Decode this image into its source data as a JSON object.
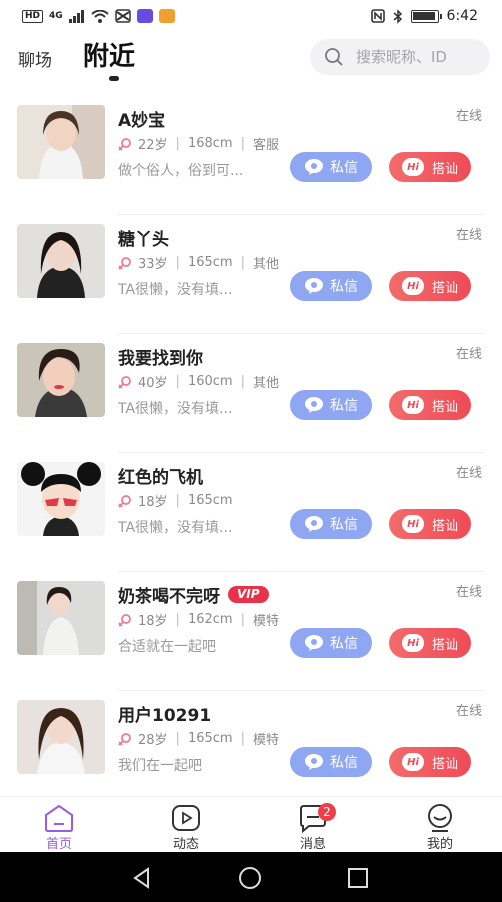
{
  "status_bar": {
    "hd": "HD",
    "signal": "4G",
    "time": "6:42"
  },
  "header": {
    "tab_plaza": "聊场",
    "tab_nearby": "附近",
    "search_placeholder": "搜索昵称、ID"
  },
  "users": [
    {
      "name": "A妙宝",
      "vip": false,
      "online": "在线",
      "age": "22岁",
      "height": "168cm",
      "job": "客服",
      "bio": "做个俗人，俗到可...",
      "msg_label": "私信",
      "hi_label": "搭讪",
      "hi_badge": "Hi"
    },
    {
      "name": "糖丫头",
      "vip": false,
      "online": "在线",
      "age": "33岁",
      "height": "165cm",
      "job": "其他",
      "bio": "TA很懒，没有填...",
      "msg_label": "私信",
      "hi_label": "搭讪",
      "hi_badge": "Hi"
    },
    {
      "name": "我要找到你",
      "vip": false,
      "online": "在线",
      "age": "40岁",
      "height": "160cm",
      "job": "其他",
      "bio": "TA很懒，没有填...",
      "msg_label": "私信",
      "hi_label": "搭讪",
      "hi_badge": "Hi"
    },
    {
      "name": "红色的飞机",
      "vip": false,
      "online": "在线",
      "age": "18岁",
      "height": "165cm",
      "job": "",
      "bio": "TA很懒，没有填...",
      "msg_label": "私信",
      "hi_label": "搭讪",
      "hi_badge": "Hi"
    },
    {
      "name": "奶茶喝不完呀",
      "vip": true,
      "vip_label": "VIP",
      "online": "在线",
      "age": "18岁",
      "height": "162cm",
      "job": "模特",
      "bio": "合适就在一起吧",
      "msg_label": "私信",
      "hi_label": "搭讪",
      "hi_badge": "Hi"
    },
    {
      "name": "用户10291",
      "vip": false,
      "online": "在线",
      "age": "28岁",
      "height": "165cm",
      "job": "模特",
      "bio": "我们在一起吧",
      "msg_label": "私信",
      "hi_label": "搭讪",
      "hi_badge": "Hi"
    }
  ],
  "bottom_nav": {
    "items": [
      {
        "label": "首页",
        "icon": "home-icon",
        "active": true
      },
      {
        "label": "动态",
        "icon": "play-icon",
        "active": false
      },
      {
        "label": "消息",
        "icon": "message-icon",
        "active": false,
        "badge": "2"
      },
      {
        "label": "我的",
        "icon": "profile-icon",
        "active": false
      }
    ]
  },
  "colors": {
    "accent": "#9a5ce0",
    "msg_button": "#8fa6f2",
    "hi_button": "#ef4b57",
    "vip": "#e8324a"
  }
}
